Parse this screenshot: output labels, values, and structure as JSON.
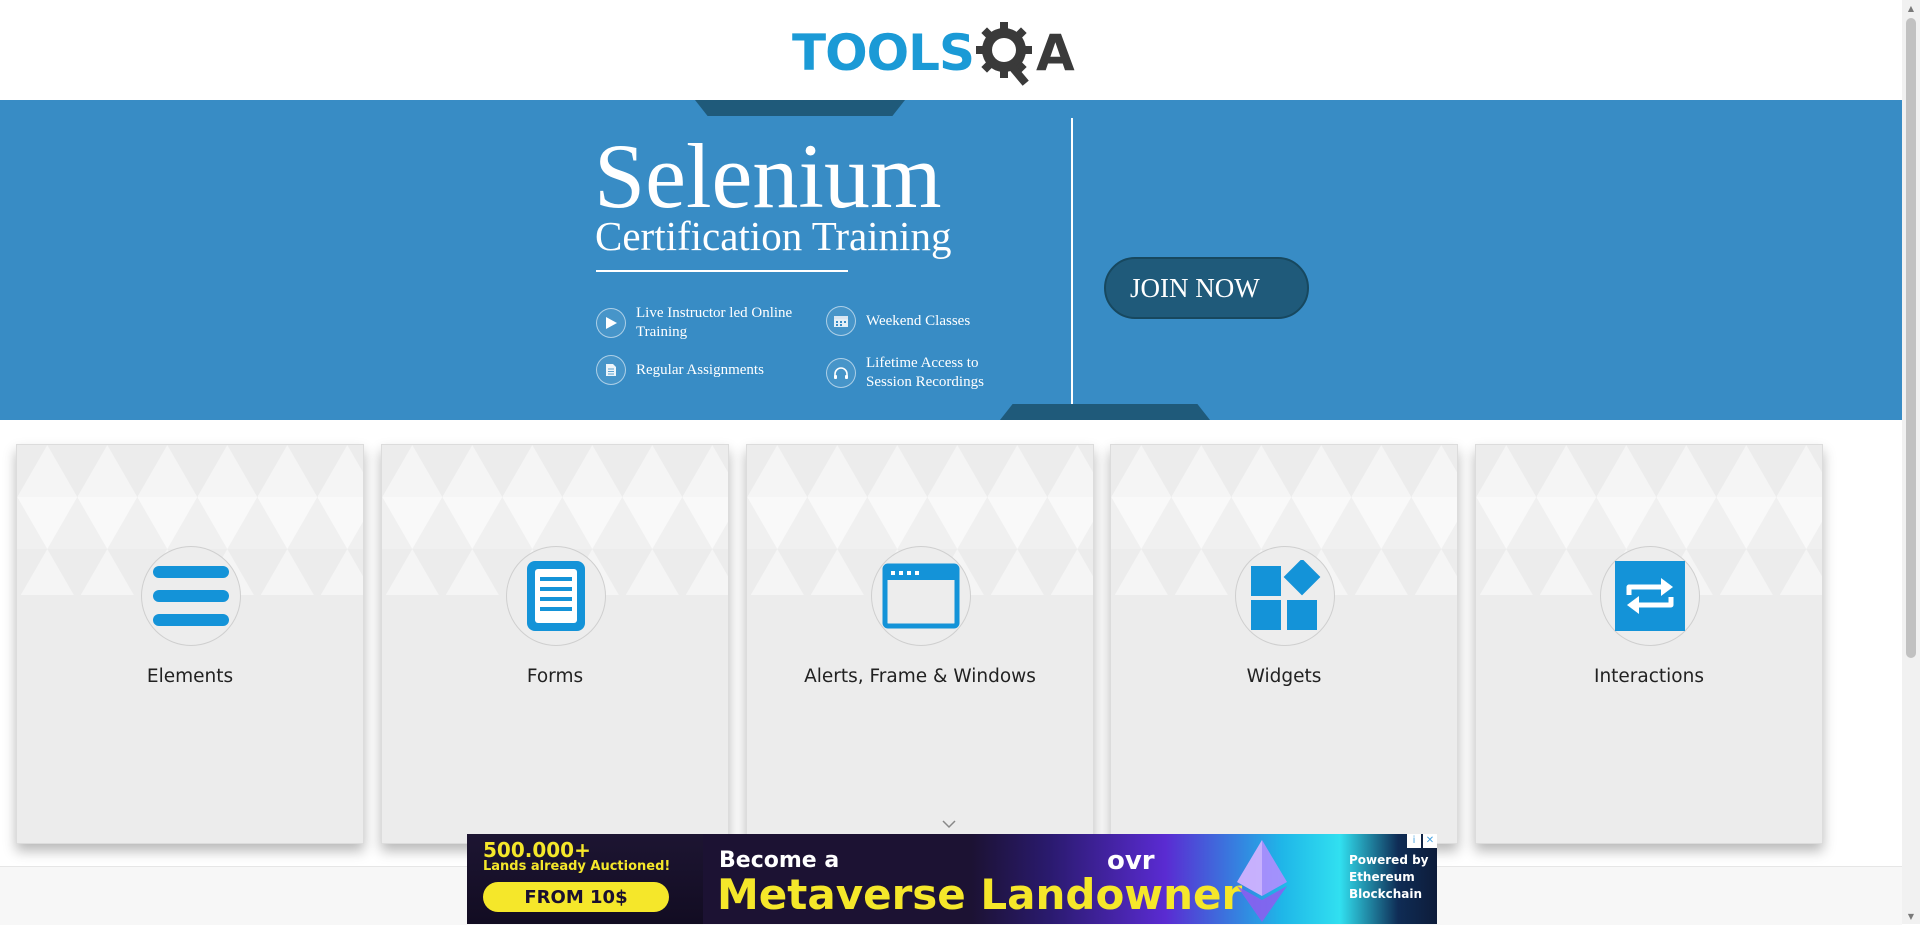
{
  "header": {
    "logo_part1": "TOOLS",
    "logo_part2": "A",
    "logo_icon": "gear-magnifier-icon"
  },
  "banner": {
    "title": "Selenium",
    "subtitle": "Certification Training",
    "features": [
      {
        "icon": "play-icon",
        "text": "Live Instructor led Online Training"
      },
      {
        "icon": "calendar-icon",
        "text": "Weekend Classes"
      },
      {
        "icon": "document-icon",
        "text": "Regular Assignments"
      },
      {
        "icon": "headphones-icon",
        "text": "Lifetime Access to Session Recordings"
      }
    ],
    "cta_label": "JOIN NOW"
  },
  "cards": [
    {
      "label": "Elements",
      "icon": "hamburger-icon"
    },
    {
      "label": "Forms",
      "icon": "form-document-icon"
    },
    {
      "label": "Alerts, Frame & Windows",
      "icon": "browser-window-icon"
    },
    {
      "label": "Widgets",
      "icon": "widgets-icon"
    },
    {
      "label": "Interactions",
      "icon": "swap-arrows-icon"
    }
  ],
  "ad": {
    "stat": "500.000+",
    "stat_caption": "Lands already Auctioned!",
    "cta": "FROM 10$",
    "headline_small": "Become a",
    "headline_big": "Metaverse Landowner",
    "brand": "ovr",
    "powered": "Powered by Ethereum Blockchain",
    "choices_info": "i",
    "choices_close": "✕"
  },
  "colors": {
    "brand_blue": "#1b9ad6",
    "banner_blue": "#388cc5",
    "banner_dark": "#1f5a7a",
    "card_bg": "#ececec",
    "icon_blue": "#1493d8",
    "ad_yellow": "#f5e72a"
  }
}
